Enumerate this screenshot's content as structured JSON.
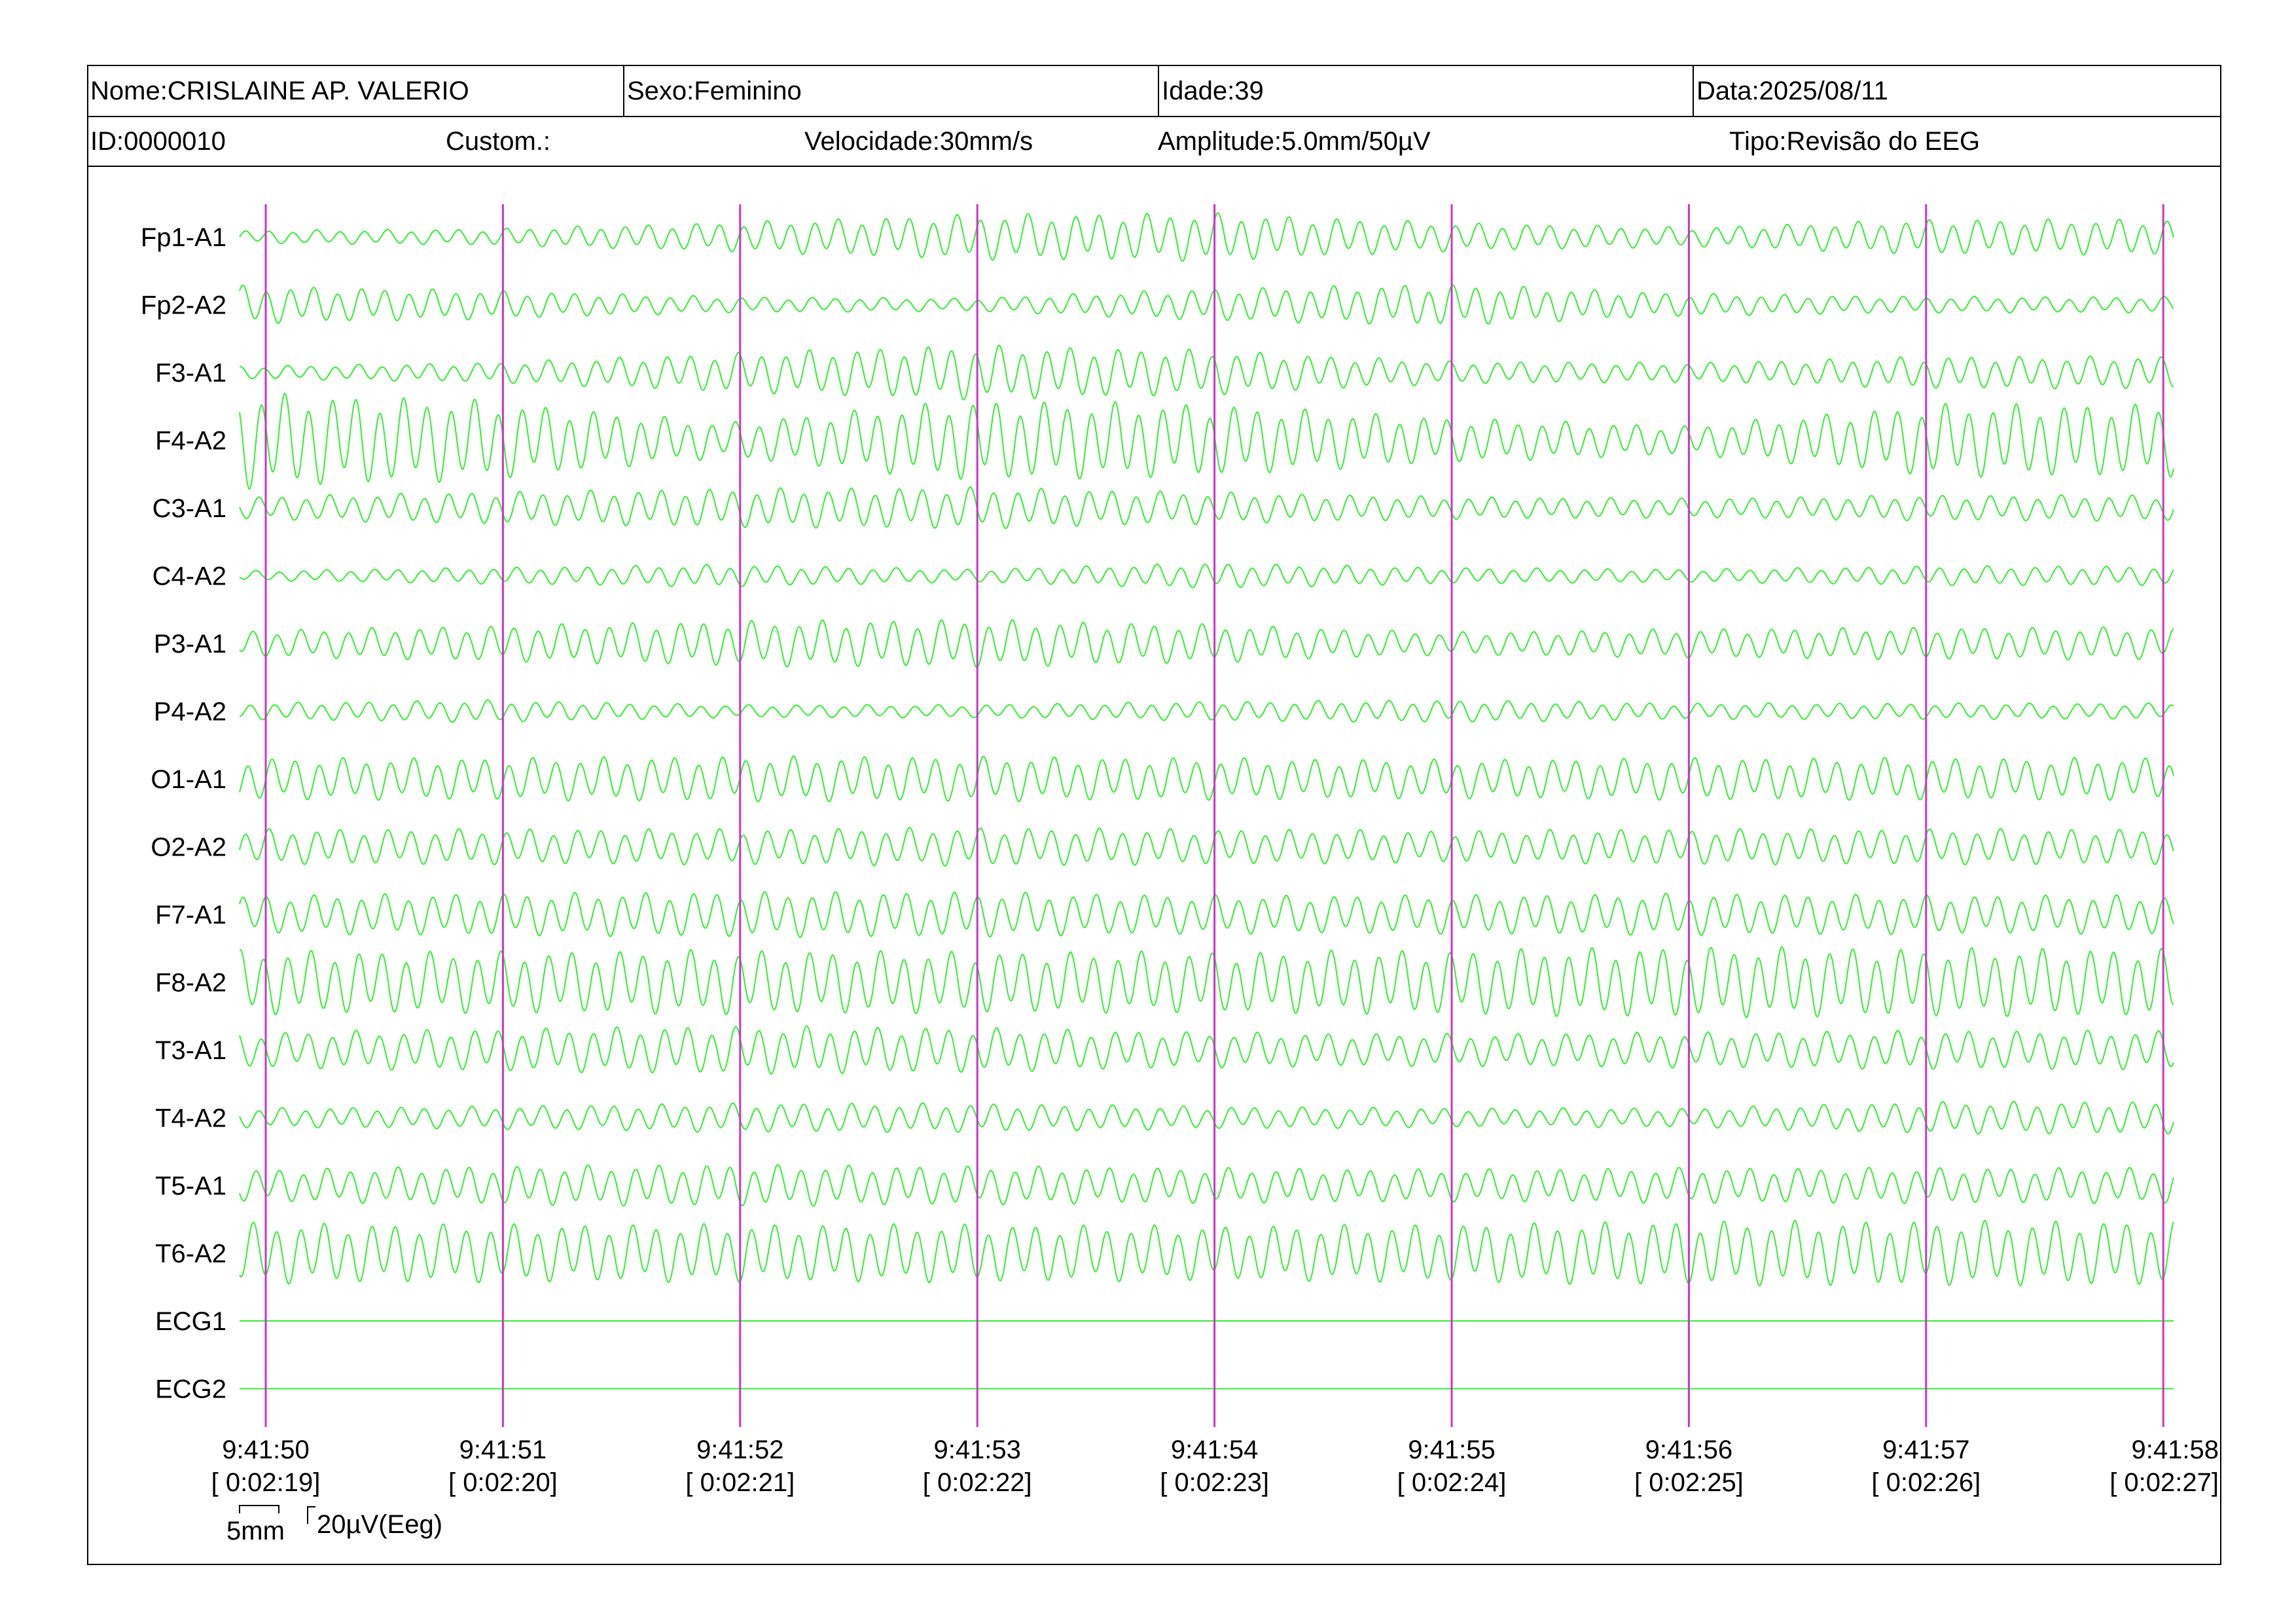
{
  "header": {
    "nome": "Nome:CRISLAINE AP. VALERIO",
    "sexo": "Sexo:Feminino",
    "idade": "Idade:39",
    "data": "Data:2025/08/11",
    "id": "ID:0000010",
    "custom": "Custom.:",
    "velocidade": "Velocidade:30mm/s",
    "amplitude": "Amplitude:5.0mm/50µV",
    "tipo": "Tipo:Revisão do EEG"
  },
  "colors": {
    "trace": "#33ee33",
    "marker": "#cc33cc",
    "border": "#000000"
  },
  "channels": [
    {
      "label": "Fp1-A1",
      "amplitude_uv": [
        8,
        10,
        18,
        28,
        30,
        18,
        12,
        22
      ]
    },
    {
      "label": "Fp2-A2",
      "amplitude_uv": [
        24,
        18,
        10,
        8,
        20,
        26,
        14,
        10
      ]
    },
    {
      "label": "F3-A1",
      "amplitude_uv": [
        8,
        12,
        24,
        34,
        28,
        14,
        12,
        20
      ]
    },
    {
      "label": "F4-A2",
      "amplitude_uv": [
        60,
        50,
        22,
        50,
        45,
        28,
        18,
        45
      ]
    },
    {
      "label": "C3-A1",
      "amplitude_uv": [
        14,
        20,
        24,
        26,
        20,
        14,
        12,
        16
      ]
    },
    {
      "label": "C4-A2",
      "amplitude_uv": [
        6,
        10,
        14,
        8,
        16,
        10,
        8,
        12
      ]
    },
    {
      "label": "P3-A1",
      "amplitude_uv": [
        16,
        22,
        28,
        30,
        24,
        14,
        18,
        20
      ]
    },
    {
      "label": "P4-A2",
      "amplitude_uv": [
        10,
        14,
        8,
        8,
        12,
        14,
        10,
        10
      ]
    },
    {
      "label": "O1-A1",
      "amplitude_uv": [
        26,
        26,
        28,
        28,
        26,
        24,
        26,
        26
      ]
    },
    {
      "label": "O2-A2",
      "amplitude_uv": [
        22,
        22,
        22,
        24,
        22,
        20,
        22,
        22
      ]
    },
    {
      "label": "F7-A1",
      "amplitude_uv": [
        24,
        26,
        28,
        28,
        24,
        24,
        26,
        24
      ]
    },
    {
      "label": "F8-A2",
      "amplitude_uv": [
        40,
        38,
        40,
        38,
        38,
        40,
        44,
        42
      ]
    },
    {
      "label": "T3-A1",
      "amplitude_uv": [
        22,
        26,
        30,
        28,
        22,
        20,
        22,
        24
      ]
    },
    {
      "label": "T4-A2",
      "amplitude_uv": [
        12,
        14,
        18,
        18,
        14,
        12,
        12,
        20
      ]
    },
    {
      "label": "T5-A1",
      "amplitude_uv": [
        20,
        24,
        26,
        24,
        22,
        20,
        22,
        22
      ]
    },
    {
      "label": "T6-A2",
      "amplitude_uv": [
        38,
        36,
        36,
        36,
        34,
        36,
        40,
        40
      ]
    },
    {
      "label": "ECG1",
      "amplitude_uv": [
        0,
        0,
        0,
        0,
        0,
        0,
        0,
        0
      ]
    },
    {
      "label": "ECG2",
      "amplitude_uv": [
        0,
        0,
        0,
        0,
        0,
        0,
        0,
        0
      ]
    }
  ],
  "time_markers": [
    {
      "time": "9:41:50",
      "elapsed": "[ 0:02:19]"
    },
    {
      "time": "9:41:51",
      "elapsed": "[ 0:02:20]"
    },
    {
      "time": "9:41:52",
      "elapsed": "[ 0:02:21]"
    },
    {
      "time": "9:41:53",
      "elapsed": "[ 0:02:22]"
    },
    {
      "time": "9:41:54",
      "elapsed": "[ 0:02:23]"
    },
    {
      "time": "9:41:55",
      "elapsed": "[ 0:02:24]"
    },
    {
      "time": "9:41:56",
      "elapsed": "[ 0:02:25]"
    },
    {
      "time": "9:41:57",
      "elapsed": "[ 0:02:26]"
    },
    {
      "time": "9:41:58",
      "elapsed": "[ 0:02:27]"
    }
  ],
  "scale": {
    "time_label": "5mm",
    "amp_label": "20µV(Eeg)"
  }
}
